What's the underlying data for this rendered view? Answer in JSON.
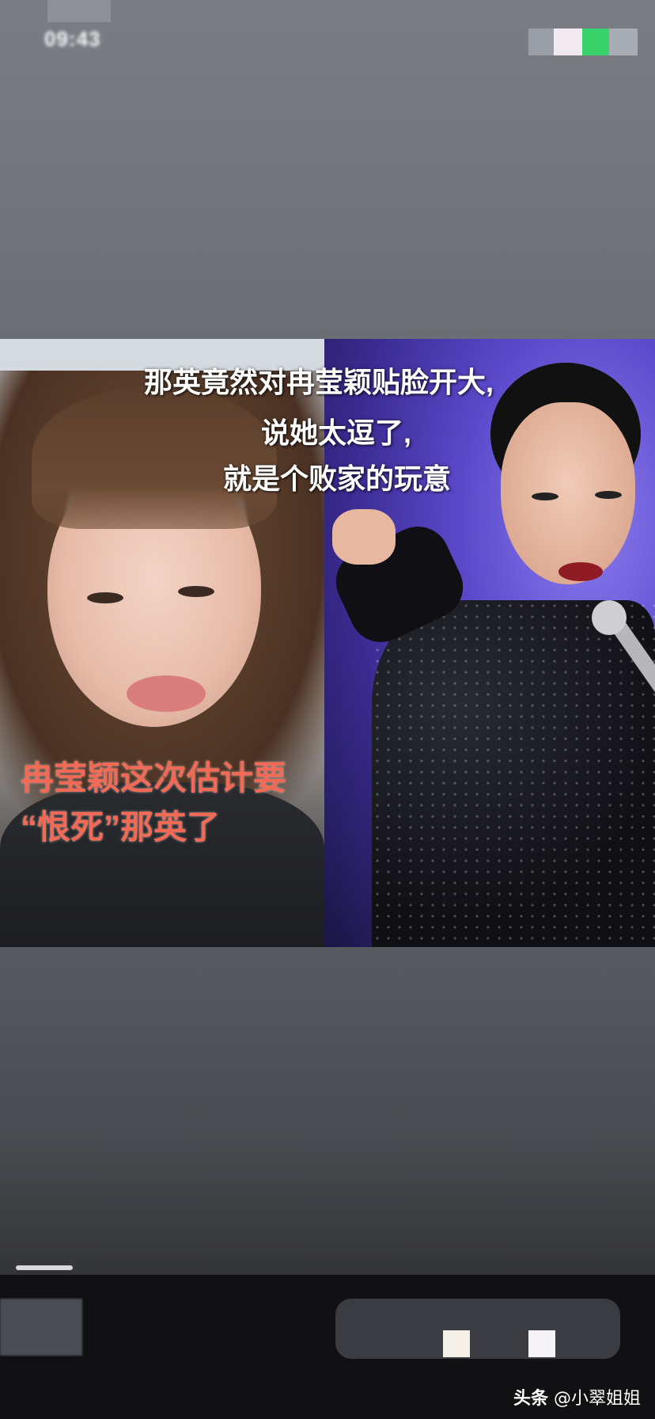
{
  "status_bar": {
    "time": "09:43"
  },
  "captions": {
    "white_line1": "那英竟然对冉莹颖贴脸开大,",
    "white_line2": "说她太逗了,",
    "white_line3": "就是个败家的玩意",
    "red_line1": "冉莹颖这次估计要",
    "red_line2": "“恨死”那英了"
  },
  "watermark": {
    "brand": "头条",
    "author": "@小翠姐姐"
  },
  "colors": {
    "caption_red": "#f26a55",
    "stage_purple": "#5a48c9",
    "status_green": "#39d16a"
  }
}
